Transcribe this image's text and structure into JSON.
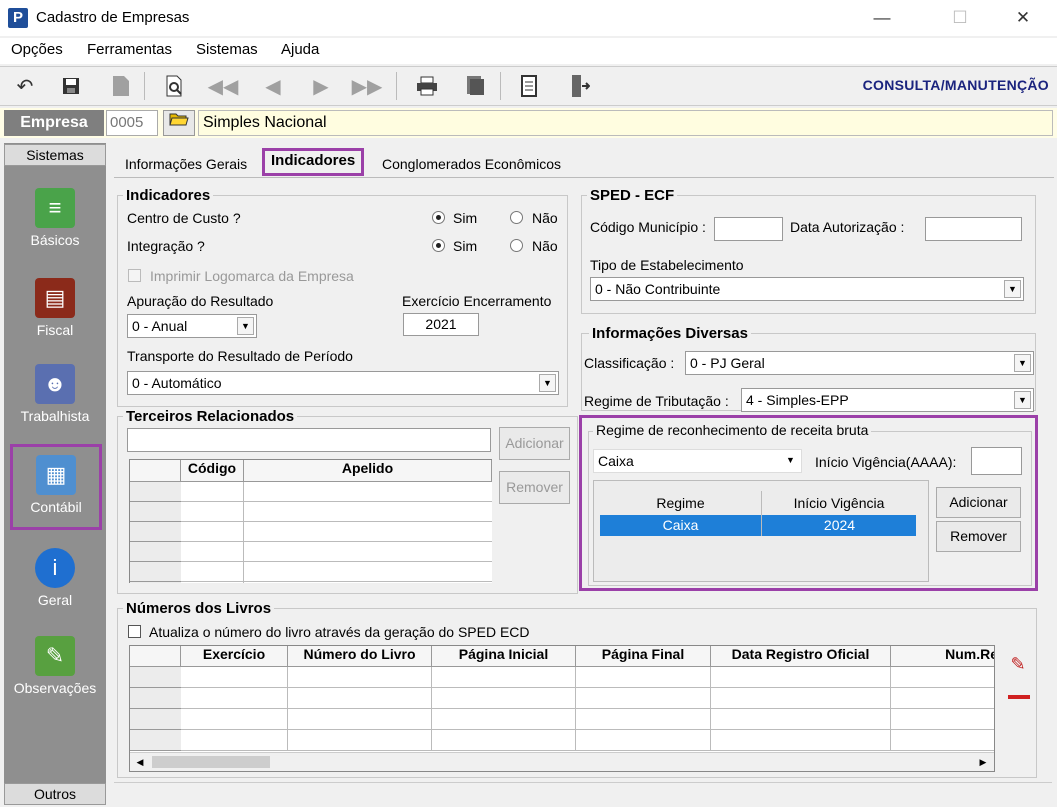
{
  "window": {
    "title": "Cadastro de Empresas",
    "app_icon": "P",
    "minimize": "—",
    "maximize": "☐",
    "close": "✕"
  },
  "menu": [
    "Opções",
    "Ferramentas",
    "Sistemas",
    "Ajuda"
  ],
  "toolbar": {
    "mode": "CONSULTA/MANUTENÇÃO"
  },
  "empresa": {
    "label": "Empresa",
    "code": "0005",
    "name": "Simples Nacional"
  },
  "sidebar": {
    "header": "Sistemas",
    "footer": "Outros",
    "items": [
      "Básicos",
      "Fiscal",
      "Trabalhista",
      "Contábil",
      "Geral",
      "Observações"
    ]
  },
  "tabs": [
    "Informações Gerais",
    "Indicadores",
    "Conglomerados Econômicos"
  ],
  "indicadores": {
    "title": "Indicadores",
    "centro_custo": "Centro de Custo ?",
    "integracao": "Integração ?",
    "sim": "Sim",
    "nao": "Não",
    "imprimir_logo": "Imprimir Logomarca da Empresa",
    "apuracao_label": "Apuração do Resultado",
    "apuracao_value": "0 - Anual",
    "exercicio_label": "Exercício Encerramento",
    "exercicio_value": "2021",
    "transporte_label": "Transporte do Resultado de Período",
    "transporte_value": "0 - Automático"
  },
  "terceiros": {
    "title": "Terceiros Relacionados",
    "add": "Adicionar",
    "remove": "Remover",
    "col_codigo": "Código",
    "col_apelido": "Apelido"
  },
  "sped": {
    "title": "SPED - ECF",
    "codigo_municipio": "Código Município :",
    "data_autorizacao": "Data Autorização :",
    "tipo_label": "Tipo de Estabelecimento",
    "tipo_value": "0 - Não Contribuinte"
  },
  "diversas": {
    "title": "Informações Diversas",
    "classificacao_label": "Classificação :",
    "classificacao_value": "0 - PJ Geral",
    "regime_label": "Regime de Tributação :",
    "regime_value": "4 - Simples-EPP"
  },
  "receita": {
    "title": "Regime de reconhecimento de receita bruta",
    "select_value": "Caixa",
    "inicio_label": "Início Vigência(AAAA):",
    "col_regime": "Regime",
    "col_inicio": "Início Vigência",
    "row_regime": "Caixa",
    "row_inicio": "2024",
    "add": "Adicionar",
    "remove": "Remover"
  },
  "livros": {
    "title": "Números dos Livros",
    "checkbox": "Atualiza o número do livro através da geração do SPED ECD",
    "cols": [
      "Exercício",
      "Número do Livro",
      "Página Inicial",
      "Página Final",
      "Data Registro Oficial",
      "Num.Re"
    ]
  }
}
